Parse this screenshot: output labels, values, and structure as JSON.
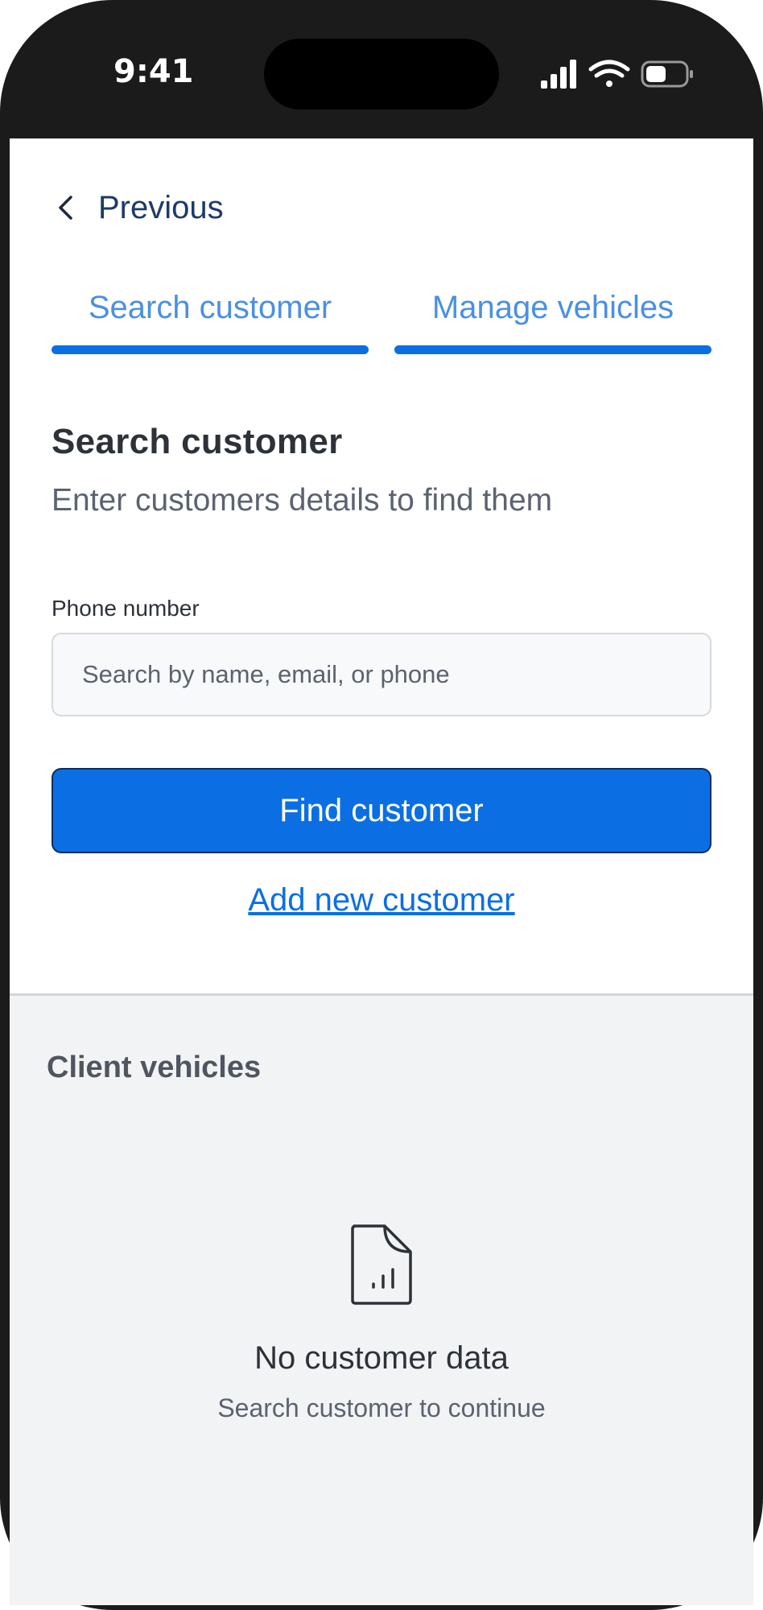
{
  "status_bar": {
    "time": "9:41"
  },
  "nav": {
    "back_label": "Previous"
  },
  "tabs": [
    {
      "label": "Search customer"
    },
    {
      "label": "Manage vehicles"
    }
  ],
  "search": {
    "title": "Search customer",
    "subtitle": "Enter customers details to find them",
    "field_label": "Phone number",
    "placeholder": "Search by name, email, or phone",
    "value": "",
    "find_button": "Find customer",
    "add_link": "Add new customer"
  },
  "client_vehicles": {
    "title": "Client vehicles",
    "empty_icon": "document-chart-icon",
    "empty_title": "No customer data",
    "empty_subtitle": "Search customer to continue"
  },
  "colors": {
    "accent": "#0b6fe3",
    "tab_text": "#4a90e2",
    "frame": "#1b1b1b",
    "lower_bg": "#f2f3f5"
  }
}
